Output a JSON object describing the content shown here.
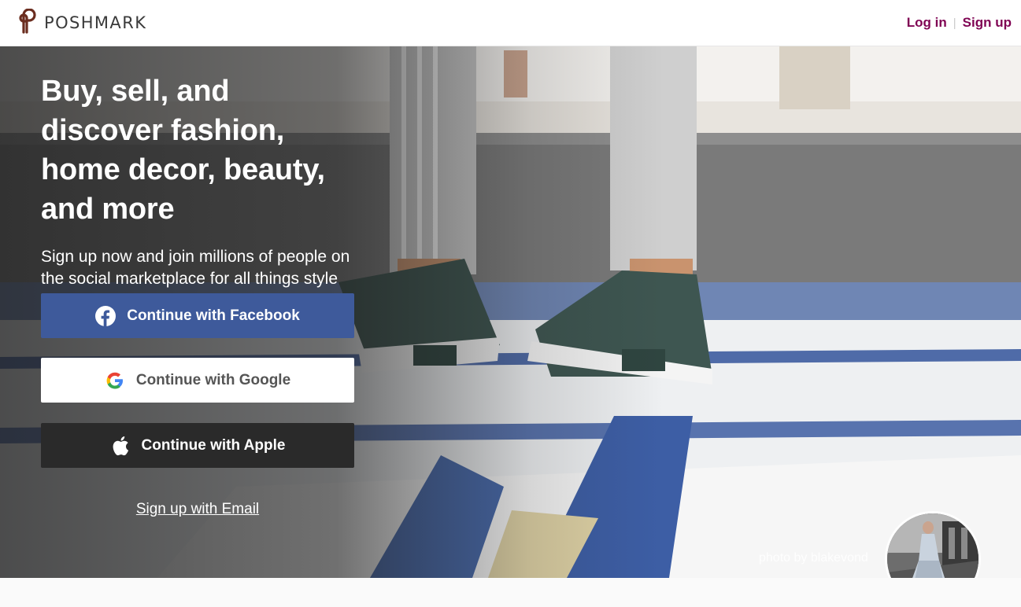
{
  "header": {
    "brand_name": "POSHMARK",
    "login_label": "Log in",
    "separator": "|",
    "signup_label": "Sign up"
  },
  "hero": {
    "title": "Buy, sell, and discover fashion, home decor, beauty, and more",
    "subtitle": "Sign up now and join millions of people on the social marketplace for all things style",
    "facebook_label": "Continue with Facebook",
    "google_label": "Continue with Google",
    "apple_label": "Continue with Apple",
    "email_label": "Sign up with Email",
    "photo_credit": "photo by blakevond"
  },
  "icons": {
    "brand": "poshmark-logo-icon",
    "facebook": "facebook-icon",
    "google": "google-icon",
    "apple": "apple-icon"
  },
  "colors": {
    "brand": "#7f0353",
    "facebook": "#3e5a9b",
    "apple": "#2a2a2a",
    "google": "#ffffff"
  }
}
